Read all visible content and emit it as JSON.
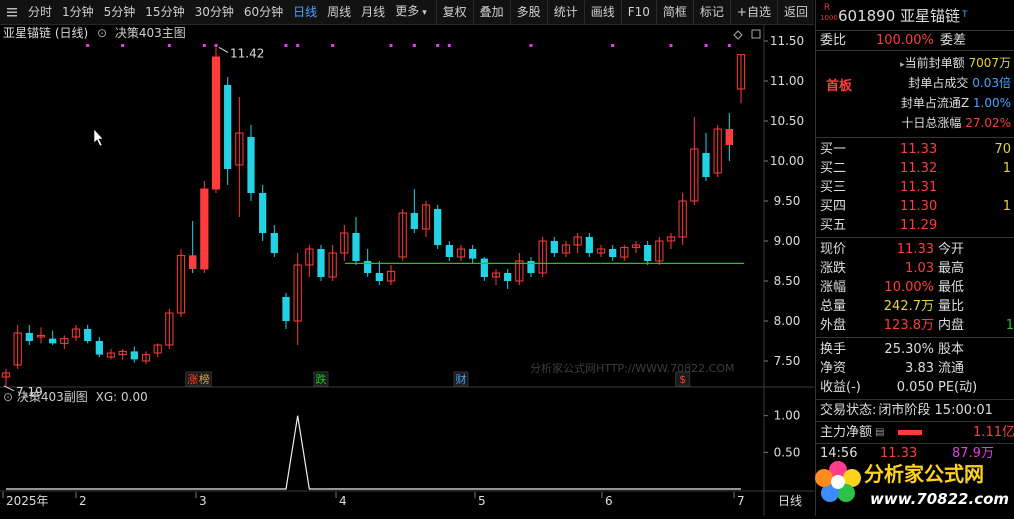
{
  "toolbar": {
    "periods": [
      "分时",
      "1分钟",
      "5分钟",
      "15分钟",
      "30分钟",
      "60分钟",
      "日线",
      "周线",
      "月线",
      "更多"
    ],
    "active_period": "日线",
    "buttons": [
      "复权",
      "叠加",
      "多股",
      "统计",
      "画线",
      "F10",
      "简框",
      "标记",
      "+自选",
      "返回"
    ]
  },
  "chart": {
    "stock_title": "亚星锚链 (日线)",
    "indicator_name": "决策403主图",
    "high_label": "11.42",
    "low_label": "7.19",
    "watermark": "分析家公式网HTTP://WWW.70822.COM",
    "markers": [
      "涨",
      "榜",
      "跌",
      "财",
      "$"
    ],
    "sub_title": "决策403副图",
    "sub_value": "XG: 0.00",
    "period_label": "日线",
    "colors": {
      "up": "#ff3c3c",
      "down": "#22d3e6",
      "support": "#21c421",
      "marker_dot": "#e040e0"
    }
  },
  "chart_data": {
    "type": "candlestick",
    "y_ticks": [
      "11.50",
      "11.00",
      "10.50",
      "10.00",
      "9.50",
      "9.00",
      "8.50",
      "8.00",
      "7.50"
    ],
    "x_ticks": [
      "2025年",
      "2",
      "3",
      "4",
      "5",
      "6",
      "7"
    ],
    "ylim": [
      7.2,
      11.6
    ],
    "support_level": 8.72,
    "subchart": {
      "y_ticks": [
        "1.00",
        "0.50"
      ],
      "ylim": [
        0,
        1.2
      ],
      "signal_index": 25,
      "signal_value": 1.0
    },
    "candles": [
      {
        "o": 7.3,
        "h": 7.4,
        "l": 7.19,
        "c": 7.35
      },
      {
        "o": 7.45,
        "h": 7.95,
        "l": 7.4,
        "c": 7.85
      },
      {
        "o": 7.85,
        "h": 7.95,
        "l": 7.7,
        "c": 7.75
      },
      {
        "o": 7.8,
        "h": 7.92,
        "l": 7.72,
        "c": 7.82
      },
      {
        "o": 7.78,
        "h": 7.88,
        "l": 7.7,
        "c": 7.72
      },
      {
        "o": 7.72,
        "h": 7.82,
        "l": 7.65,
        "c": 7.78
      },
      {
        "o": 7.8,
        "h": 7.95,
        "l": 7.75,
        "c": 7.9
      },
      {
        "o": 7.9,
        "h": 7.95,
        "l": 7.72,
        "c": 7.75
      },
      {
        "o": 7.75,
        "h": 7.8,
        "l": 7.55,
        "c": 7.58
      },
      {
        "o": 7.55,
        "h": 7.65,
        "l": 7.52,
        "c": 7.6
      },
      {
        "o": 7.58,
        "h": 7.65,
        "l": 7.52,
        "c": 7.62
      },
      {
        "o": 7.62,
        "h": 7.68,
        "l": 7.48,
        "c": 7.52
      },
      {
        "o": 7.5,
        "h": 7.62,
        "l": 7.46,
        "c": 7.58
      },
      {
        "o": 7.6,
        "h": 7.72,
        "l": 7.55,
        "c": 7.7
      },
      {
        "o": 7.7,
        "h": 8.15,
        "l": 7.65,
        "c": 8.1
      },
      {
        "o": 8.1,
        "h": 8.9,
        "l": 8.05,
        "c": 8.82
      },
      {
        "o": 8.82,
        "h": 9.25,
        "l": 8.6,
        "c": 8.65
      },
      {
        "o": 8.65,
        "h": 9.75,
        "l": 8.6,
        "c": 9.65
      },
      {
        "o": 9.65,
        "h": 11.42,
        "l": 9.6,
        "c": 11.3
      },
      {
        "o": 10.95,
        "h": 11.05,
        "l": 9.7,
        "c": 9.9
      },
      {
        "o": 9.95,
        "h": 10.8,
        "l": 9.3,
        "c": 10.35
      },
      {
        "o": 10.3,
        "h": 10.45,
        "l": 9.5,
        "c": 9.6
      },
      {
        "o": 9.6,
        "h": 9.7,
        "l": 9.0,
        "c": 9.1
      },
      {
        "o": 9.1,
        "h": 9.2,
        "l": 8.8,
        "c": 8.85
      },
      {
        "o": 8.3,
        "h": 8.35,
        "l": 7.9,
        "c": 8.0
      },
      {
        "o": 8.0,
        "h": 8.85,
        "l": 7.7,
        "c": 8.7
      },
      {
        "o": 8.7,
        "h": 8.95,
        "l": 8.55,
        "c": 8.9
      },
      {
        "o": 8.9,
        "h": 8.95,
        "l": 8.5,
        "c": 8.55
      },
      {
        "o": 8.55,
        "h": 8.95,
        "l": 8.5,
        "c": 8.85
      },
      {
        "o": 8.85,
        "h": 9.2,
        "l": 8.75,
        "c": 9.1
      },
      {
        "o": 9.1,
        "h": 9.3,
        "l": 8.7,
        "c": 8.75
      },
      {
        "o": 8.75,
        "h": 8.9,
        "l": 8.55,
        "c": 8.6
      },
      {
        "o": 8.6,
        "h": 8.75,
        "l": 8.45,
        "c": 8.5
      },
      {
        "o": 8.5,
        "h": 8.7,
        "l": 8.45,
        "c": 8.62
      },
      {
        "o": 8.8,
        "h": 9.4,
        "l": 8.75,
        "c": 9.35
      },
      {
        "o": 9.35,
        "h": 9.65,
        "l": 9.1,
        "c": 9.15
      },
      {
        "o": 9.15,
        "h": 9.5,
        "l": 9.05,
        "c": 9.45
      },
      {
        "o": 9.4,
        "h": 9.45,
        "l": 8.9,
        "c": 8.95
      },
      {
        "o": 8.95,
        "h": 9.0,
        "l": 8.75,
        "c": 8.8
      },
      {
        "o": 8.8,
        "h": 8.95,
        "l": 8.75,
        "c": 8.9
      },
      {
        "o": 8.9,
        "h": 8.95,
        "l": 8.72,
        "c": 8.78
      },
      {
        "o": 8.78,
        "h": 8.8,
        "l": 8.5,
        "c": 8.55
      },
      {
        "o": 8.55,
        "h": 8.65,
        "l": 8.45,
        "c": 8.6
      },
      {
        "o": 8.6,
        "h": 8.65,
        "l": 8.4,
        "c": 8.5
      },
      {
        "o": 8.5,
        "h": 8.85,
        "l": 8.45,
        "c": 8.75
      },
      {
        "o": 8.75,
        "h": 8.8,
        "l": 8.55,
        "c": 8.6
      },
      {
        "o": 8.6,
        "h": 9.05,
        "l": 8.55,
        "c": 9.0
      },
      {
        "o": 9.0,
        "h": 9.05,
        "l": 8.8,
        "c": 8.85
      },
      {
        "o": 8.85,
        "h": 9.0,
        "l": 8.8,
        "c": 8.95
      },
      {
        "o": 8.95,
        "h": 9.1,
        "l": 8.85,
        "c": 9.05
      },
      {
        "o": 9.05,
        "h": 9.1,
        "l": 8.8,
        "c": 8.85
      },
      {
        "o": 8.85,
        "h": 8.95,
        "l": 8.8,
        "c": 8.9
      },
      {
        "o": 8.9,
        "h": 8.95,
        "l": 8.75,
        "c": 8.8
      },
      {
        "o": 8.8,
        "h": 8.95,
        "l": 8.75,
        "c": 8.92
      },
      {
        "o": 8.92,
        "h": 9.0,
        "l": 8.85,
        "c": 8.95
      },
      {
        "o": 8.95,
        "h": 9.0,
        "l": 8.7,
        "c": 8.75
      },
      {
        "o": 8.75,
        "h": 9.05,
        "l": 8.7,
        "c": 9.0
      },
      {
        "o": 9.0,
        "h": 9.1,
        "l": 8.9,
        "c": 9.05
      },
      {
        "o": 9.05,
        "h": 9.6,
        "l": 8.95,
        "c": 9.5
      },
      {
        "o": 9.5,
        "h": 10.55,
        "l": 9.45,
        "c": 10.15
      },
      {
        "o": 10.1,
        "h": 10.35,
        "l": 9.75,
        "c": 9.8
      },
      {
        "o": 9.85,
        "h": 10.45,
        "l": 9.8,
        "c": 10.4
      },
      {
        "o": 10.4,
        "h": 10.6,
        "l": 10.0,
        "c": 10.2
      },
      {
        "o": 10.9,
        "h": 11.33,
        "l": 10.72,
        "c": 11.33
      }
    ]
  },
  "quote": {
    "badge_top": "R",
    "badge_bottom": "1000",
    "code_name": "601890 亚星锚链",
    "superscript": "T",
    "weibi_label": "委比",
    "weibi_value": "100.00%",
    "weicha_label": "委差",
    "board_tag": "首板",
    "info": [
      {
        "label": "当前封单额",
        "value": "7007万",
        "color": "yel"
      },
      {
        "label": "封单占成交",
        "value": "0.03倍",
        "color": "blue"
      },
      {
        "label": "封单占流通Z",
        "value": "1.00%",
        "color": "blue"
      },
      {
        "label": "十日总涨幅",
        "value": "27.02%",
        "color": "red"
      }
    ],
    "orderbook": [
      {
        "label": "买一",
        "price": "11.33",
        "vol": "70"
      },
      {
        "label": "买二",
        "price": "11.32",
        "vol": "1"
      },
      {
        "label": "买三",
        "price": "11.31",
        "vol": ""
      },
      {
        "label": "买四",
        "price": "11.30",
        "vol": "1"
      },
      {
        "label": "买五",
        "price": "11.29",
        "vol": ""
      }
    ],
    "stats": [
      {
        "l1": "现价",
        "v1": "11.33",
        "c1": "red",
        "l2": "今开",
        "v2": "",
        "c2": ""
      },
      {
        "l1": "涨跌",
        "v1": "1.03",
        "c1": "red",
        "l2": "最高",
        "v2": "",
        "c2": ""
      },
      {
        "l1": "涨幅",
        "v1": "10.00%",
        "c1": "red",
        "l2": "最低",
        "v2": "",
        "c2": ""
      },
      {
        "l1": "总量",
        "v1": "242.7万",
        "c1": "yel",
        "l2": "量比",
        "v2": "",
        "c2": ""
      },
      {
        "l1": "外盘",
        "v1": "123.8万",
        "c1": "red",
        "l2": "内盘",
        "v2": "1",
        "c2": "grn"
      }
    ],
    "stats2": [
      {
        "l1": "换手",
        "v1": "25.30%",
        "l2": "股本"
      },
      {
        "l1": "净资",
        "v1": "3.83",
        "l2": "流通"
      },
      {
        "l1": "收益(-)",
        "v1": "0.050",
        "l2": "PE(动)"
      }
    ],
    "status_label": "交易状态:",
    "status_value": "闭市阶段 15:00:01",
    "net_label": "主力净额",
    "net_value": "1.11亿",
    "tick_time": "14:56",
    "tick_price": "11.33",
    "tick_vol": "87.9万"
  },
  "logo": {
    "text": "分析家公式网",
    "url": "www.70822.com"
  }
}
